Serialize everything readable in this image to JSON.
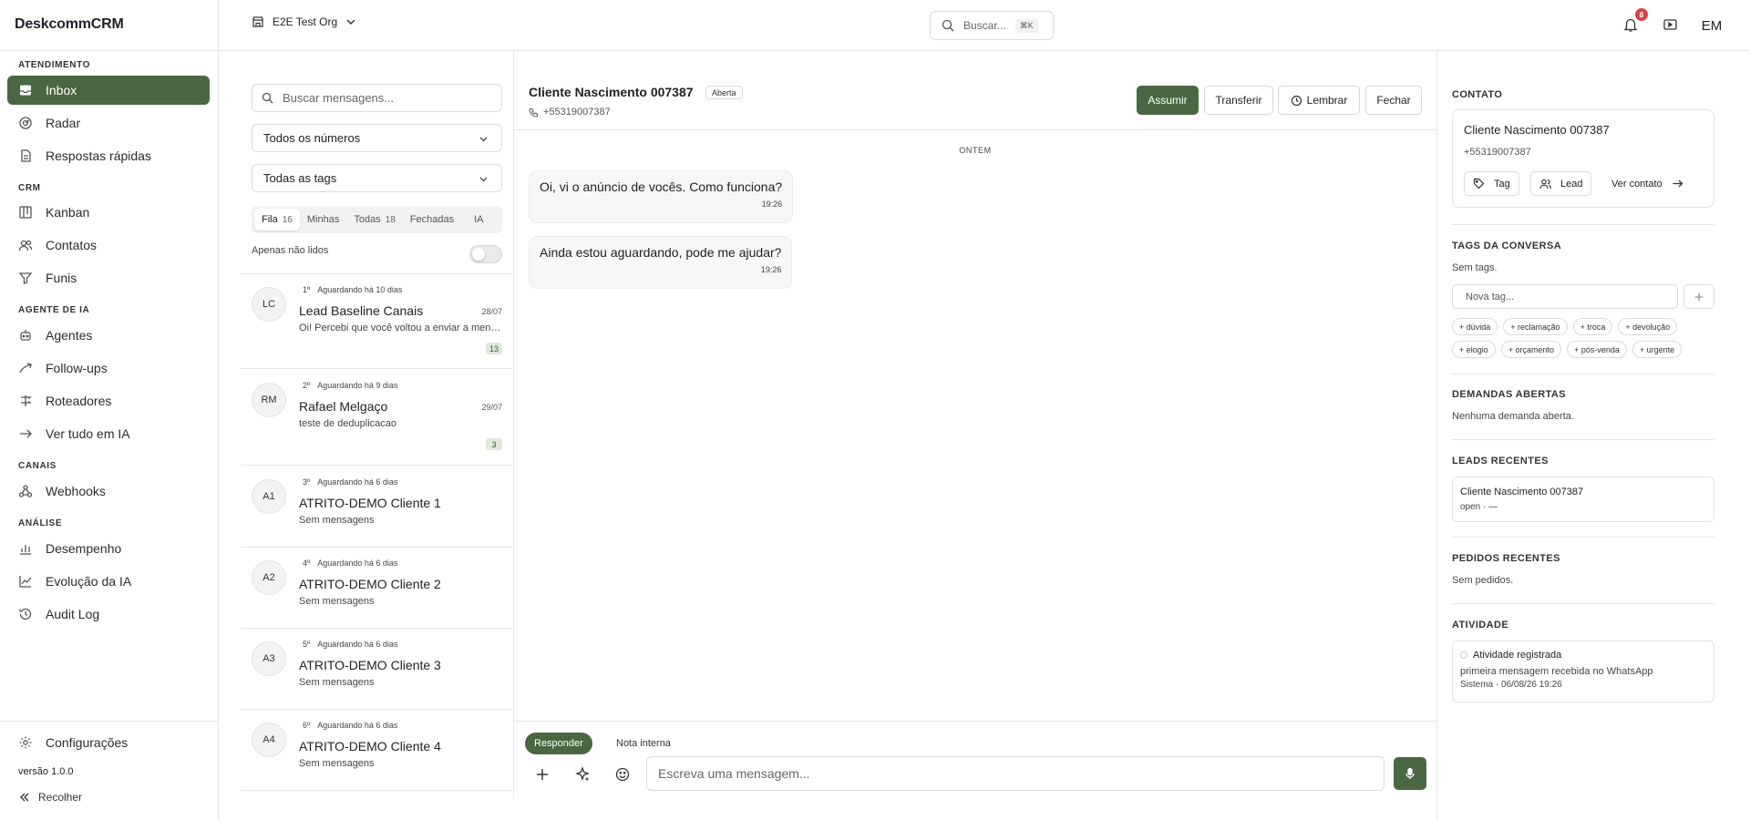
{
  "app": {
    "brand": "DeskcommCRM",
    "version": "versão 1.0.0",
    "collapse_label": "Recolher",
    "settings_label": "Configurações"
  },
  "sidebar": {
    "sections": [
      {
        "label": "ATENDIMENTO",
        "items": [
          {
            "label": "Inbox",
            "icon": "inbox-icon",
            "active": true
          },
          {
            "label": "Radar",
            "icon": "radar-icon"
          },
          {
            "label": "Respostas rápidas",
            "icon": "quick-replies-icon"
          }
        ]
      },
      {
        "label": "CRM",
        "items": [
          {
            "label": "Kanban",
            "icon": "kanban-icon"
          },
          {
            "label": "Contatos",
            "icon": "contacts-icon"
          },
          {
            "label": "Funis",
            "icon": "funnel-icon"
          }
        ]
      },
      {
        "label": "AGENTE DE IA",
        "items": [
          {
            "label": "Agentes",
            "icon": "bot-icon"
          },
          {
            "label": "Follow-ups",
            "icon": "follow-up-icon"
          },
          {
            "label": "Roteadores",
            "icon": "router-icon"
          },
          {
            "label": "Ver tudo em IA",
            "icon": "arrow-right-icon"
          }
        ]
      },
      {
        "label": "CANAIS",
        "items": [
          {
            "label": "Webhooks",
            "icon": "webhook-icon"
          }
        ]
      },
      {
        "label": "ANÁLISE",
        "items": [
          {
            "label": "Desempenho",
            "icon": "bar-chart-icon"
          },
          {
            "label": "Evolução da IA",
            "icon": "trend-icon"
          },
          {
            "label": "Audit Log",
            "icon": "history-icon"
          }
        ]
      }
    ]
  },
  "topbar": {
    "org": "E2E Test Org",
    "search_placeholder": "Buscar...",
    "search_shortcut": "⌘K",
    "notifications": "8",
    "user_initials": "EM"
  },
  "list": {
    "search_placeholder": "Buscar mensagens...",
    "numbers_select": "Todos os números",
    "tags_select": "Todas as tags",
    "tabs": [
      {
        "label": "Fila",
        "count": "16",
        "active": true
      },
      {
        "label": "Minhas",
        "count": ""
      },
      {
        "label": "Todas",
        "count": "18"
      },
      {
        "label": "Fechadas",
        "count": ""
      },
      {
        "label": "IA",
        "count": ""
      }
    ],
    "unread_label": "Apenas não lidos",
    "conversations": [
      {
        "initials": "LC",
        "position": "1º",
        "waiting": "Aguardando há 10 dias",
        "name": "Lead Baseline Canais",
        "date": "28/07",
        "preview": "Oi! Percebi que você voltou a enviar a mensagem",
        "count": "13"
      },
      {
        "initials": "RM",
        "position": "2º",
        "waiting": "Aguardando há 9 dias",
        "name": "Rafael Melgaço",
        "date": "29/07",
        "preview": "teste de deduplicacao",
        "count": "3"
      },
      {
        "initials": "A1",
        "position": "3º",
        "waiting": "Aguardando há 6 dias",
        "name": "ATRITO-DEMO Cliente 1",
        "date": "",
        "preview": "Sem mensagens",
        "count": ""
      },
      {
        "initials": "A2",
        "position": "4º",
        "waiting": "Aguardando há 6 dias",
        "name": "ATRITO-DEMO Cliente 2",
        "date": "",
        "preview": "Sem mensagens",
        "count": ""
      },
      {
        "initials": "A3",
        "position": "5º",
        "waiting": "Aguardando há 6 dias",
        "name": "ATRITO-DEMO Cliente 3",
        "date": "",
        "preview": "Sem mensagens",
        "count": ""
      },
      {
        "initials": "A4",
        "position": "6º",
        "waiting": "Aguardando há 6 dias",
        "name": "ATRITO-DEMO Cliente 4",
        "date": "",
        "preview": "Sem mensagens",
        "count": ""
      }
    ]
  },
  "chat": {
    "title": "Cliente Nascimento 007387",
    "status": "Aberta",
    "phone": "+55319007387",
    "buttons": {
      "assume": "Assumir",
      "transfer": "Transferir",
      "remind": "Lembrar",
      "close": "Fechar"
    },
    "day_label": "ONTEM",
    "messages": [
      {
        "text": "Oi, vi o anúncio de vocês. Como funciona?",
        "time": "19:26"
      },
      {
        "text": "Ainda estou aguardando, pode me ajudar?",
        "time": "19:26"
      }
    ],
    "compose": {
      "reply_tab": "Responder",
      "note_tab": "Nota interna",
      "placeholder": "Escreva uma mensagem..."
    }
  },
  "contact": {
    "section_label": "CONTATO",
    "name": "Cliente Nascimento 007387",
    "phone": "+55319007387",
    "tag_button": "Tag",
    "lead_button": "Lead",
    "view_link": "Ver contato",
    "tags_section": "TAGS DA CONVERSA",
    "no_tags": "Sem tags.",
    "new_tag_placeholder": "Nova tag...",
    "suggested_tags": [
      "+ dúvida",
      "+ reclamação",
      "+ troca",
      "+ devolução",
      "+ elogio",
      "+ orçamento",
      "+ pós-venda",
      "+ urgente"
    ],
    "demands_section": "DEMANDAS ABERTAS",
    "no_demands": "Nenhuma demanda aberta.",
    "leads_section": "LEADS RECENTES",
    "lead": {
      "name": "Cliente Nascimento 007387",
      "status": "open · —"
    },
    "orders_section": "PEDIDOS RECENTES",
    "no_orders": "Sem pedidos.",
    "activity_section": "ATIVIDADE",
    "activity": {
      "title": "Atividade registrada",
      "description": "primeira mensagem recebida no WhatsApp",
      "meta": "Sistema · 06/08/26 19:26"
    }
  },
  "colors": {
    "accent": "#4a6642",
    "badge": "#d64545",
    "count_badge_bg": "#e2e9dc"
  }
}
